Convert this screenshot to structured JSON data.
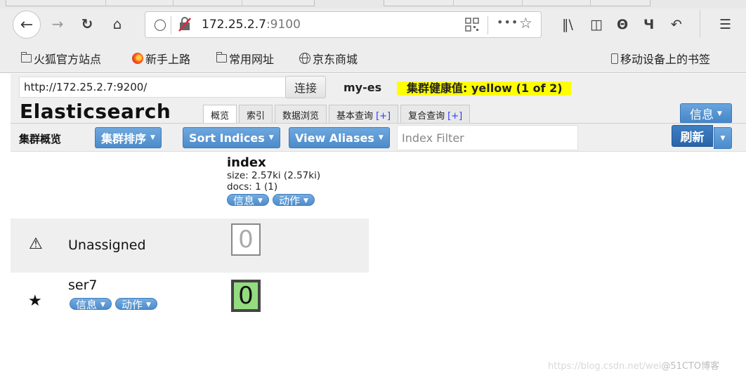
{
  "browser": {
    "url_host": "172.25.2.7",
    "url_port": ":9100",
    "toolbar_icons": [
      "back-icon",
      "forward-icon",
      "reload-icon",
      "home-icon",
      "shield-icon",
      "insecure-lock-icon",
      "qr-code-icon",
      "more-icon",
      "bookmark-star-icon",
      "library-icon",
      "sidebar-icon",
      "account-icon",
      "screenshot-icon",
      "undo-icon",
      "menu-icon"
    ],
    "bookmarks": [
      {
        "label": "火狐官方站点",
        "icon": "folder-icon"
      },
      {
        "label": "新手上路",
        "icon": "firefox-icon"
      },
      {
        "label": "常用网址",
        "icon": "folder-icon"
      },
      {
        "label": "京东商城",
        "icon": "globe-icon"
      }
    ],
    "mobile_bookmarks": "移动设备上的书签"
  },
  "app": {
    "connect_url": "http://172.25.2.7:9200/",
    "connect_button": "连接",
    "cluster_name": "my-es",
    "health": "集群健康值: yellow (1 of 2)",
    "health_color": "#ffff00",
    "logo": "Elasticsearch",
    "tabs": [
      {
        "label": "概览",
        "plus": ""
      },
      {
        "label": "索引",
        "plus": ""
      },
      {
        "label": "数据浏览",
        "plus": ""
      },
      {
        "label": "基本查询",
        "plus": "[+]"
      },
      {
        "label": "复合查询",
        "plus": "[+]"
      }
    ],
    "info_button": "信息",
    "toolbar": {
      "title": "集群概览",
      "sort_cluster": "集群排序",
      "sort_indices": "Sort Indices",
      "view_aliases": "View Aliases",
      "filter_placeholder": "Index Filter",
      "refresh": "刷新"
    },
    "index": {
      "name": "index",
      "size": "size: 2.57ki (2.57ki)",
      "docs": "docs: 1 (1)",
      "info": "信息",
      "action": "动作"
    },
    "rows": [
      {
        "label": "Unassigned",
        "icon": "warning-icon",
        "shard": "0",
        "state": "unassigned"
      },
      {
        "label": "ser7",
        "icon": "star-icon",
        "shard": "0",
        "state": "started",
        "info": "信息",
        "action": "动作"
      }
    ],
    "shard_started_color": "#93dc80"
  },
  "watermark": {
    "url": "https://blog.csdn.net/wei",
    "brand": "@51CTO博客"
  }
}
